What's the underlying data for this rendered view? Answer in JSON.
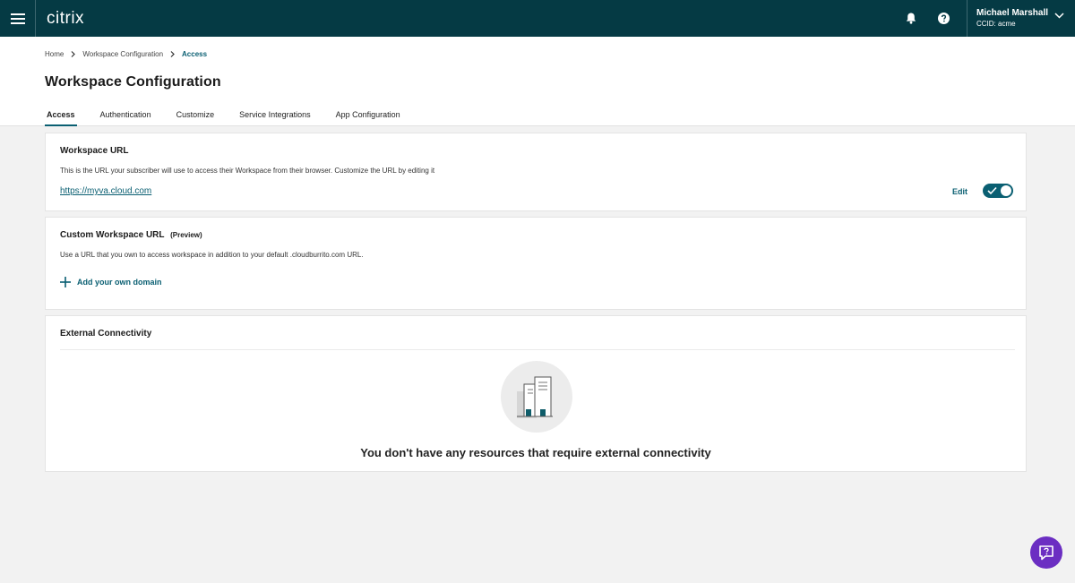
{
  "topbar": {
    "logo": "citrix",
    "user_name": "Michael Marshall",
    "user_ccid": "CCID: acme"
  },
  "breadcrumb": {
    "home": "Home",
    "section": "Workspace Configuration",
    "current": "Access"
  },
  "page": {
    "title": "Workspace Configuration"
  },
  "tabs": [
    {
      "label": "Access"
    },
    {
      "label": "Authentication"
    },
    {
      "label": "Customize"
    },
    {
      "label": "Service Integrations"
    },
    {
      "label": "App Configuration"
    }
  ],
  "workspace_url": {
    "title": "Workspace URL",
    "description": "This is the URL your subscriber will use to access their Workspace from their browser. Customize the URL by editing it",
    "url": "https://myva.cloud.com",
    "edit_label": "Edit",
    "toggle_on": true
  },
  "custom_url": {
    "title": "Custom Workspace URL",
    "badge": "(Preview)",
    "description": "Use a URL that you own to access workspace in addition to your default .cloudburrito.com URL.",
    "add_label": "Add your own domain"
  },
  "external": {
    "title": "External Connectivity",
    "empty_message": "You don't have any resources that require external connectivity"
  },
  "colors": {
    "topbar": "#053a44",
    "accent": "#0a5f72",
    "fab": "#6b2ec2"
  }
}
